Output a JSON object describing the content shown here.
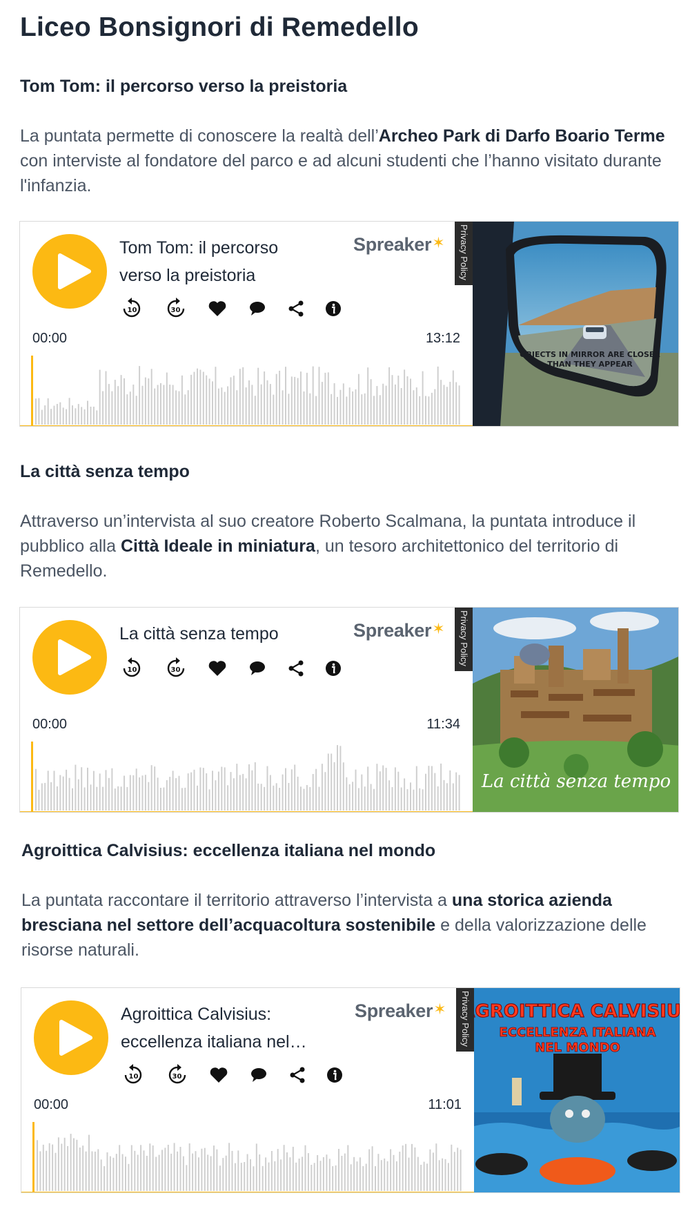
{
  "site": {
    "title": "Liceo Bonsignori di Remedello"
  },
  "colors": {
    "accent": "#fcb913",
    "wave": "#cfcfcf",
    "text": "#1f2937",
    "muted": "#4b5563"
  },
  "episodes": [
    {
      "heading": "Tom Tom: il percorso verso la preistoria",
      "desc": [
        {
          "text": "La puntata permette di conoscere la realtà dell’",
          "bold": false
        },
        {
          "text": "Archeo Park di Darfo Boario Terme",
          "bold": true
        },
        {
          "text": " con interviste al fondatore del parco e ad alcuni studenti che l’hanno visitato durante l'infanzia.",
          "bold": false
        }
      ],
      "player": {
        "title": "Tom Tom: il percorso verso la preistoria",
        "brand": "Spreaker",
        "privacy": "Privacy Policy",
        "time_start": "00:00",
        "time_end": "13:12",
        "progress": 0,
        "cover_text": [
          "OBJECTS IN MIRROR ARE CLOSER",
          "THAN THEY APPEAR"
        ]
      }
    },
    {
      "heading": "La città senza tempo",
      "desc": [
        {
          "text": "Attraverso un’intervista al suo creatore Roberto Scalmana, la puntata introduce il pubblico alla ",
          "bold": false
        },
        {
          "text": "Città Ideale in miniatura",
          "bold": true
        },
        {
          "text": ", un tesoro architettonico del territorio di Remedello.",
          "bold": false
        }
      ],
      "player": {
        "title": "La città senza tempo",
        "brand": "Spreaker",
        "privacy": "Privacy Policy",
        "time_start": "00:00",
        "time_end": "11:34",
        "progress": 0,
        "cover_text": [
          "La città senza tempo"
        ]
      }
    },
    {
      "heading": "Agroittica Calvisius: eccellenza italiana nel mondo",
      "desc": [
        {
          "text": "La puntata raccontare il territorio attraverso l’intervista a ",
          "bold": false
        },
        {
          "text": "una storica azienda bresciana nel settore dell’acquacoltura sostenibile",
          "bold": true
        },
        {
          "text": " e della valorizzazione delle risorse naturali.",
          "bold": false
        }
      ],
      "player": {
        "title": "Agroittica Calvisius: eccellenza italiana nel mondo",
        "brand": "Spreaker",
        "privacy": "Privacy Policy",
        "time_start": "00:00",
        "time_end": "11:01",
        "progress": 0,
        "cover_text": [
          "AGROITTICA CALVISIUS",
          "ECCELLENZA ITALIANA",
          "NEL MONDO"
        ]
      }
    }
  ],
  "controls": [
    {
      "name": "rewind-10-icon",
      "label": "10"
    },
    {
      "name": "forward-30-icon",
      "label": "30"
    },
    {
      "name": "like-heart-icon"
    },
    {
      "name": "comment-icon"
    },
    {
      "name": "share-icon"
    },
    {
      "name": "info-icon"
    }
  ]
}
